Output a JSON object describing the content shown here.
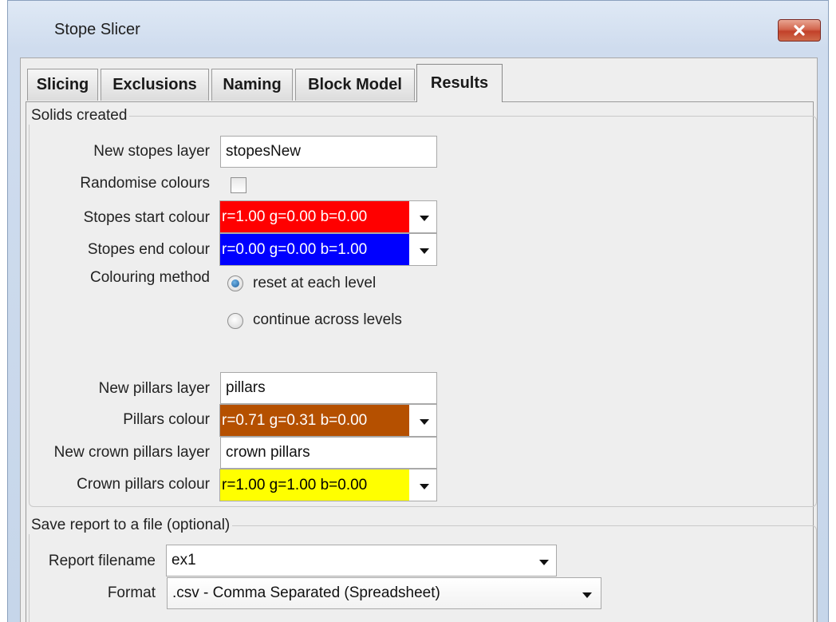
{
  "window": {
    "title": "Stope Slicer",
    "close_icon": "close-icon"
  },
  "tabs": [
    {
      "label": "Slicing",
      "active": false
    },
    {
      "label": "Exclusions",
      "active": false
    },
    {
      "label": "Naming",
      "active": false
    },
    {
      "label": "Block Model",
      "active": false
    },
    {
      "label": "Results",
      "active": true
    }
  ],
  "solids": {
    "group_title": "Solids created",
    "new_stopes_layer": {
      "label": "New stopes layer",
      "value": "stopesNew"
    },
    "randomise_colours": {
      "label": "Randomise colours",
      "checked": false
    },
    "stopes_start_colour": {
      "label": "Stopes start colour",
      "value": "r=1.00 g=0.00 b=0.00",
      "color": "#ff0000",
      "text_color": "#ffffff"
    },
    "stopes_end_colour": {
      "label": "Stopes end colour",
      "value": "r=0.00 g=0.00 b=1.00",
      "color": "#0000ff",
      "text_color": "#ffffff"
    },
    "colouring_method": {
      "label": "Colouring method",
      "options": [
        {
          "label": "reset at each level",
          "selected": true
        },
        {
          "label": "continue across levels",
          "selected": false
        }
      ]
    },
    "new_pillars_layer": {
      "label": "New pillars layer",
      "value": "pillars"
    },
    "pillars_colour": {
      "label": "Pillars colour",
      "value": "r=0.71 g=0.31 b=0.00",
      "color": "#b55000",
      "text_color": "#ffffff"
    },
    "new_crown_pillars_layer": {
      "label": "New crown pillars layer",
      "value": "crown pillars"
    },
    "crown_pillars_colour": {
      "label": "Crown pillars colour",
      "value": "r=1.00 g=1.00 b=0.00",
      "color": "#ffff00",
      "text_color": "#000000"
    }
  },
  "report": {
    "group_title": "Save report to a file (optional)",
    "filename": {
      "label": "Report filename",
      "value": "ex1"
    },
    "format": {
      "label": "Format",
      "value": ".csv - Comma Separated (Spreadsheet)"
    }
  }
}
